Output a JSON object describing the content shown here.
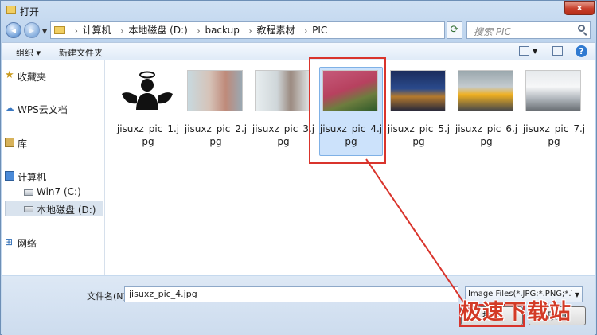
{
  "window": {
    "title": "打开",
    "close_glyph": "x"
  },
  "address": {
    "crumbs": [
      "计算机",
      "本地磁盘 (D:)",
      "backup",
      "教程素材",
      "PIC"
    ],
    "sep": "›"
  },
  "search": {
    "placeholder": "搜索 PIC"
  },
  "toolbar": {
    "organize_label": "组织 ▾",
    "new_folder_label": "新建文件夹",
    "help_glyph": "?"
  },
  "nav": {
    "favorites": "收藏夹",
    "wps": "WPS云文档",
    "library": "库",
    "computer": "计算机",
    "drive_c": "Win7 (C:)",
    "drive_d": "本地磁盘 (D:)",
    "network": "网络"
  },
  "files": [
    {
      "name": "jisuxz_pic_1.jpg"
    },
    {
      "name": "jisuxz_pic_2.jpg"
    },
    {
      "name": "jisuxz_pic_3.jpg"
    },
    {
      "name": "jisuxz_pic_4.jpg",
      "selected": true
    },
    {
      "name": "jisuxz_pic_5.jpg"
    },
    {
      "name": "jisuxz_pic_6.jpg"
    },
    {
      "name": "jisuxz_pic_7.jpg"
    }
  ],
  "bottom": {
    "filename_label": "文件名(N):",
    "filename_value": "jisuxz_pic_4.jpg",
    "filter_value": "Image Files(*.JPG;*.PNG;*.TIF",
    "open_label": "打开",
    "cancel_label": "取消"
  },
  "watermark": "极速下载站",
  "colors": {
    "highlight": "#d9342c",
    "selection": "#cce2fb"
  }
}
